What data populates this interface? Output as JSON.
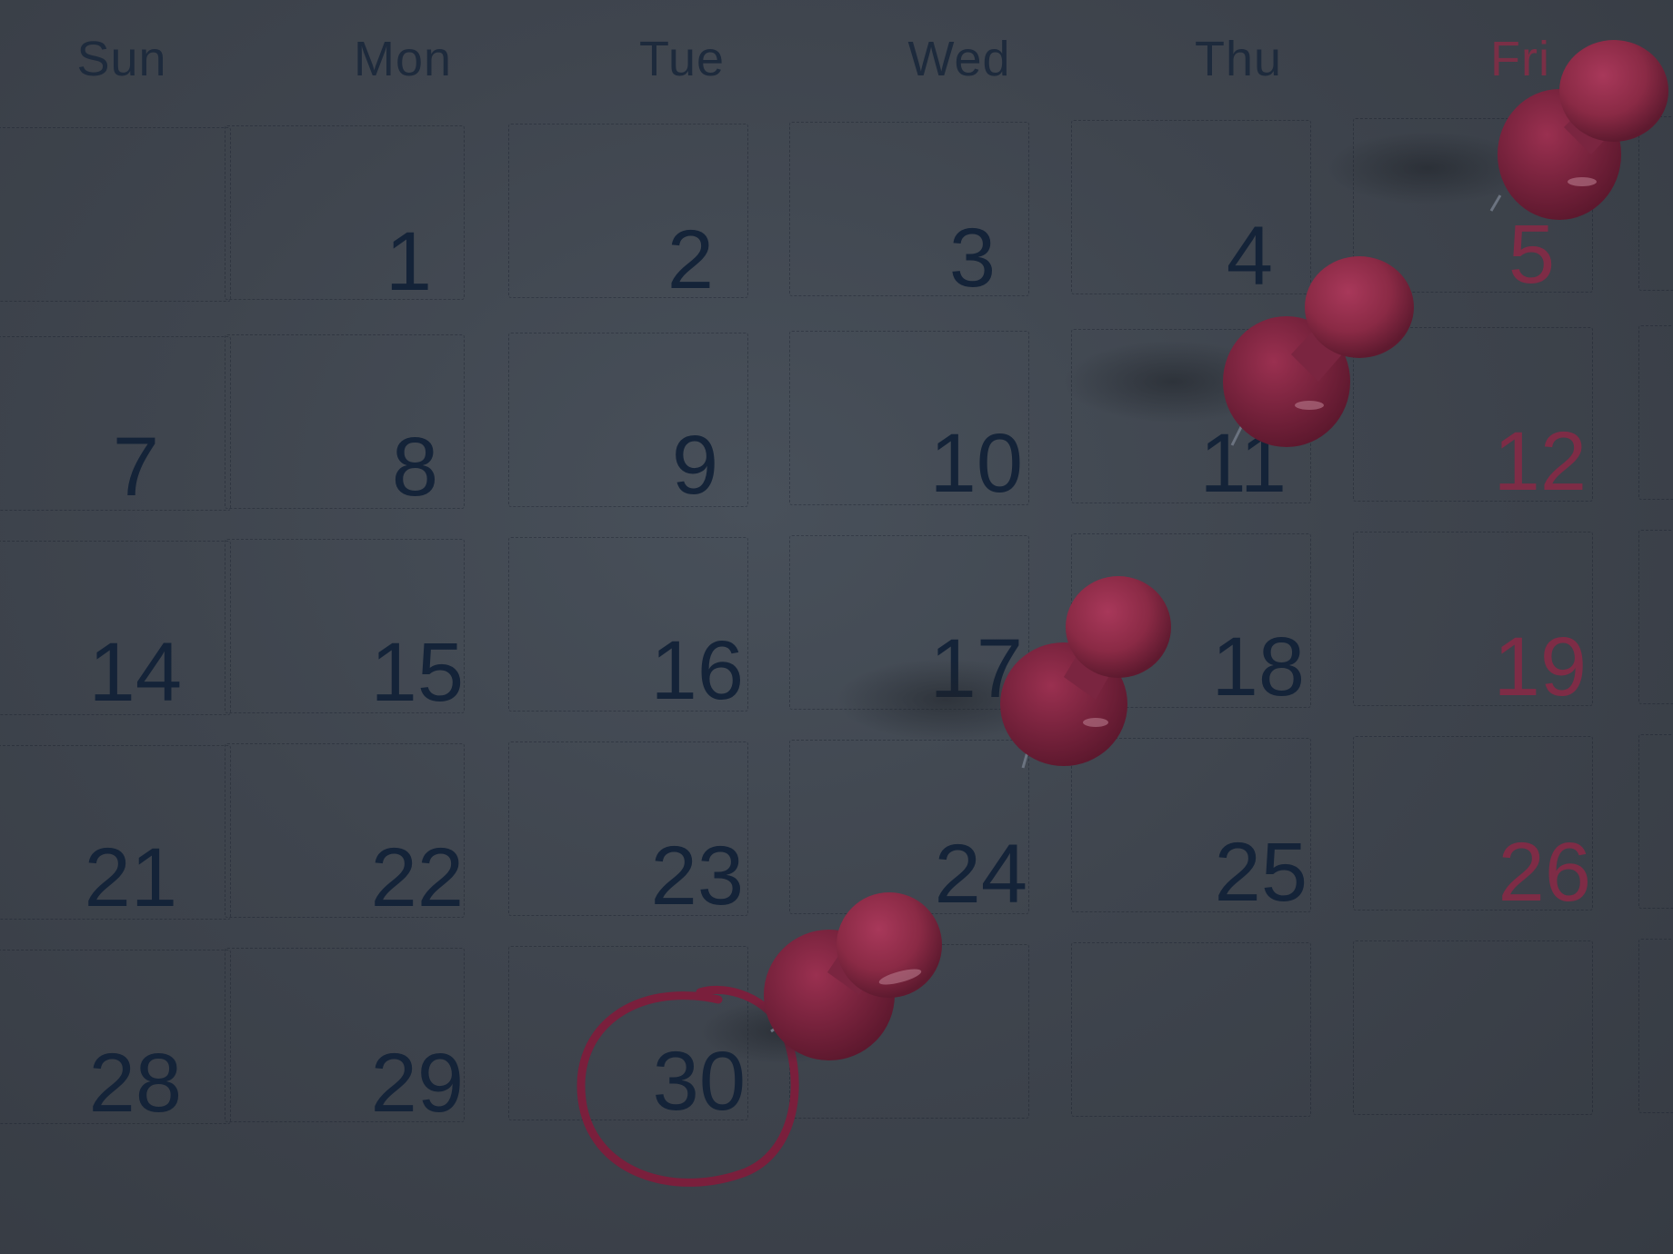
{
  "calendar": {
    "weekdays": [
      "Sun",
      "Mon",
      "Tue",
      "Wed",
      "Thu",
      "Fri"
    ],
    "weeks": [
      [
        "",
        "1",
        "2",
        "3",
        "4",
        "5"
      ],
      [
        "7",
        "8",
        "9",
        "10",
        "11",
        "12"
      ],
      [
        "14",
        "15",
        "16",
        "17",
        "18",
        "19"
      ],
      [
        "21",
        "22",
        "23",
        "24",
        "25",
        "26"
      ],
      [
        "28",
        "29",
        "30",
        "",
        "",
        ""
      ]
    ],
    "circled_day": "30",
    "pinned_days": [
      "5",
      "11",
      "17",
      "24"
    ]
  },
  "colors": {
    "background": "#3c424b",
    "text": "#142338",
    "friday_text": "#7e2c46",
    "pin": "#8a2a45",
    "circle": "#7a1f3c"
  }
}
